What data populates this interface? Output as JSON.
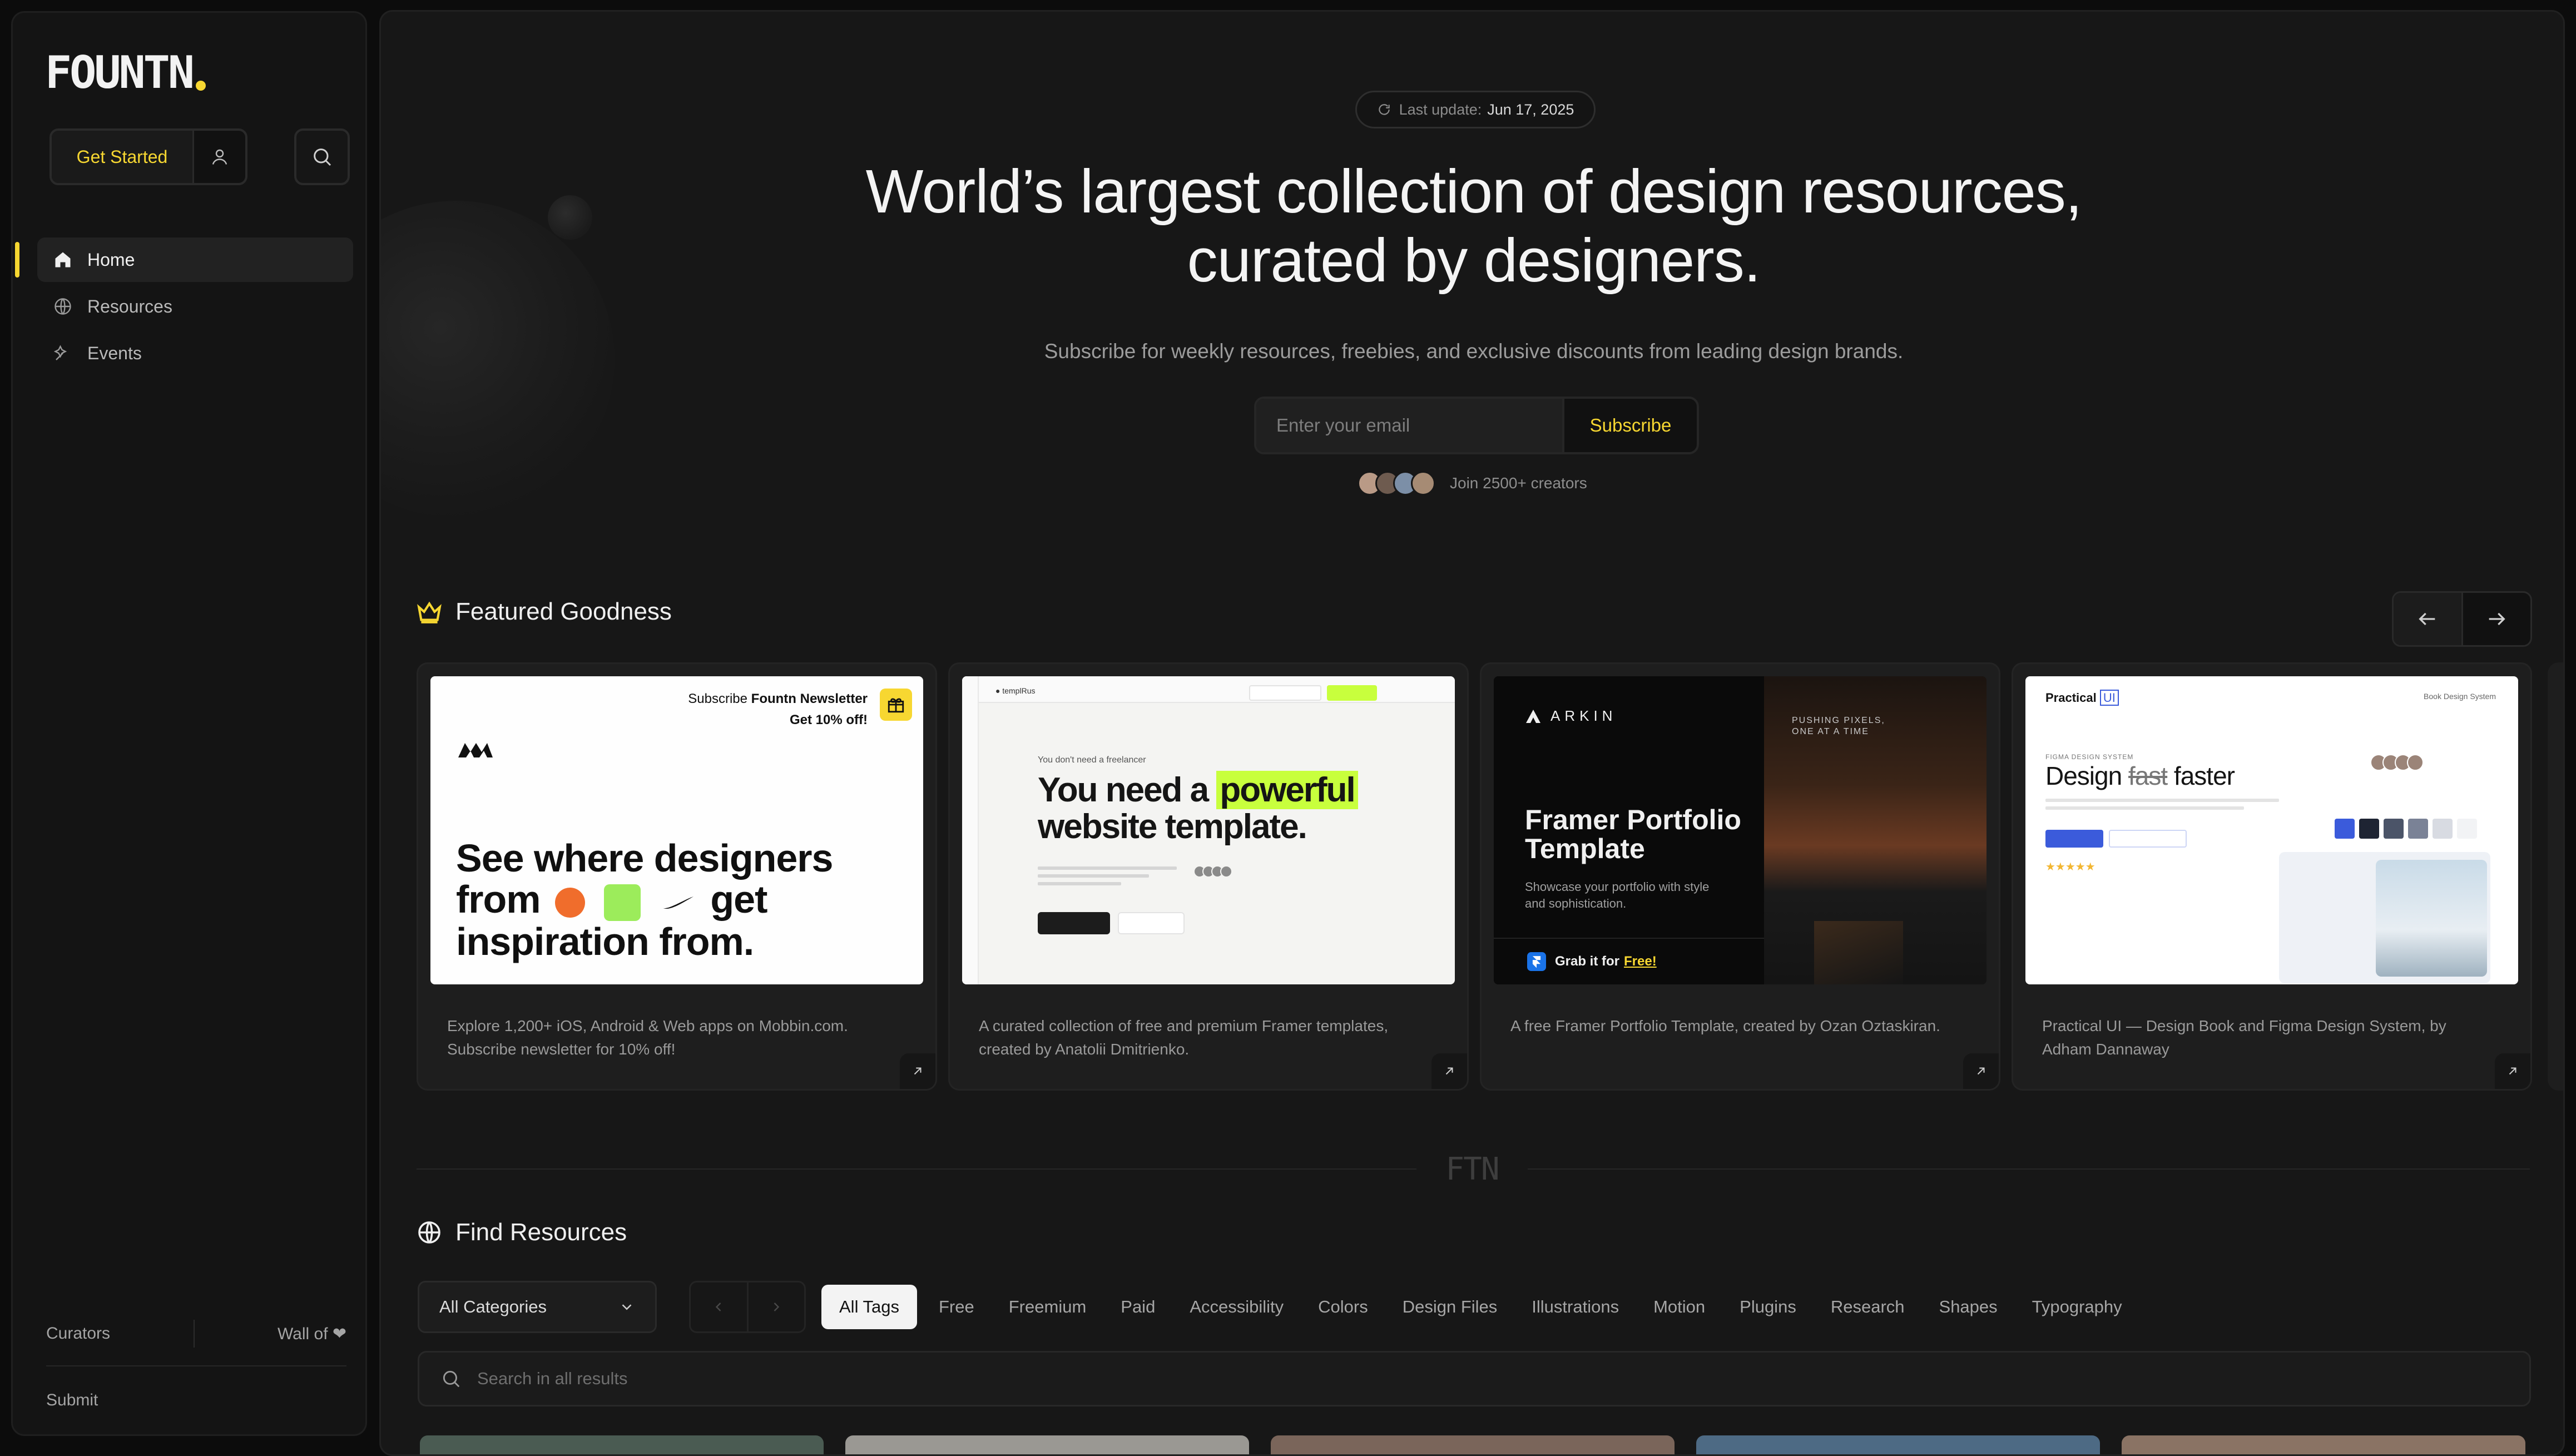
{
  "sidebar": {
    "logo_text": "FOUNTN",
    "get_started_label": "Get Started",
    "nav": [
      {
        "label": "Home",
        "icon": "home-icon",
        "active": true
      },
      {
        "label": "Resources",
        "icon": "globe-icon",
        "active": false
      },
      {
        "label": "Events",
        "icon": "events-icon",
        "active": false
      }
    ],
    "footer": {
      "curators_label": "Curators",
      "wall_of_label": "Wall of ❤",
      "submit_label": "Submit"
    }
  },
  "hero": {
    "last_update_label": "Last update:",
    "last_update_date": "Jun 17, 2025",
    "title": "World’s largest collection of design resources, curated by designers.",
    "subtitle": "Subscribe for weekly resources, freebies, and exclusive discounts from leading design brands.",
    "email_placeholder": "Enter your email",
    "subscribe_label": "Subscribe",
    "creators_text": "Join 2500+ creators"
  },
  "featured": {
    "title": "Featured Goodness",
    "cards": [
      {
        "description": "Explore 1,200+ iOS, Android & Web apps on Mobbin.com. Subscribe newsletter for 10% off!",
        "thumb": {
          "promo_prefix": "Subscribe",
          "promo_brand": "Fountn Newsletter",
          "promo_offer": "Get 10% off!",
          "headline_line1": "See where designers",
          "headline_from": "from",
          "headline_get": "get",
          "headline_line3": "inspiration from."
        }
      },
      {
        "description": "A curated collection of free and premium Framer templates, created by Anatolii Dmitrienko.",
        "thumb": {
          "small": "You don't need a freelancer",
          "headline_a": "You need a",
          "headline_highlight": "powerful",
          "headline_b": "website template."
        }
      },
      {
        "description": "A free Framer Portfolio Template, created by Ozan Oztaskiran.",
        "thumb": {
          "brand": "ARKIN",
          "title": "Framer Portfolio Template",
          "subtitle": "Showcase your portfolio with style and sophistication.",
          "cta": "Grab it for",
          "cta_free": "Free!",
          "right_text": "PUSHING PIXELS, ONE AT A TIME"
        }
      },
      {
        "description": "Practical UI — Design Book and Figma Design System, by Adham Dannaway",
        "thumb": {
          "logo_a": "Practical",
          "logo_b": "UI",
          "nav": "Book   Design System",
          "kicker": "FIGMA DESIGN SYSTEM",
          "title_a": "Design",
          "title_strike": "fast",
          "title_b": "faster"
        }
      }
    ]
  },
  "divider_mark": "FTN",
  "find_resources": {
    "title": "Find Resources",
    "category_selected": "All Categories",
    "tags": [
      "All Tags",
      "Free",
      "Freemium",
      "Paid",
      "Accessibility",
      "Colors",
      "Design Files",
      "Illustrations",
      "Motion",
      "Plugins",
      "Research",
      "Shapes",
      "Typography"
    ],
    "search_placeholder": "Search in all results"
  },
  "colors": {
    "accent": "#f7d731",
    "background": "#0c0c0c",
    "panel": "#171717"
  }
}
